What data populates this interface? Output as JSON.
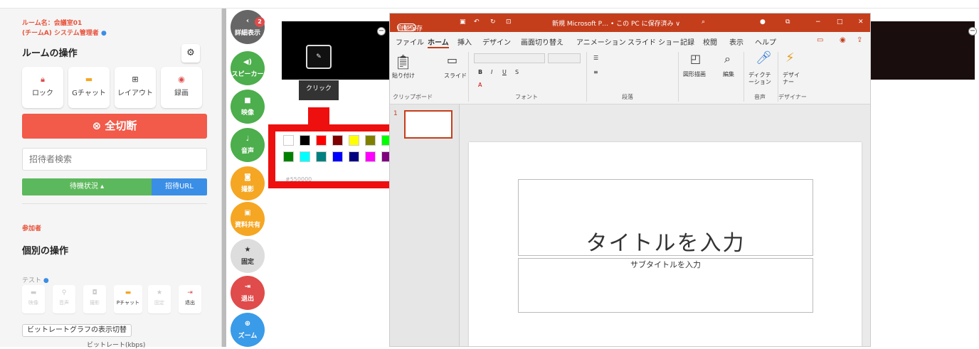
{
  "room": {
    "name": "ルーム名：会議室01",
    "team": "(チームA) システム管理者"
  },
  "ops": {
    "title": "ルームの操作",
    "items": [
      "ロック",
      "Gチャット",
      "レイアウト",
      "録画"
    ],
    "all_cut": "⊗ 全切断"
  },
  "search": {
    "placeholder": "招待者検索"
  },
  "wait_label": "待機状況 ▴",
  "invite_url": "招待URL",
  "participants": "参加者",
  "individual": "個別の操作",
  "test": "テスト",
  "indiv_items": [
    "映像",
    "音声",
    "撮影",
    "Pチャット",
    "固定",
    "退出"
  ],
  "bitrate_toggle": "ビットレートグラフの表示切替",
  "bitrate_unit": "ビットレート(kbps)",
  "side": {
    "badge": "2",
    "items": [
      "詳細表示",
      "スピーカー",
      "映像",
      "音声",
      "撮影",
      "資料共有",
      "固定",
      "退出",
      "ズーム"
    ]
  },
  "draw": {
    "click": "クリック",
    "hex": "#550000"
  },
  "palette": [
    "#ffffff",
    "#000000",
    "#ff0000",
    "#800000",
    "#ffff00",
    "#808000",
    "#00ff00",
    "#008000",
    "#00ffff",
    "#008080",
    "#0000ff",
    "#000080",
    "#ff00ff",
    "#800080"
  ],
  "ppt": {
    "autosave": "自動保存",
    "toggle": "オフ",
    "title": "新規 Microsoft P… • この PC に保存済み ∨",
    "tabs": [
      "ファイル",
      "ホーム",
      "挿入",
      "デザイン",
      "画面切り替え",
      "アニメーション",
      "スライド ショー",
      "記録",
      "校閲",
      "表示",
      "ヘルプ"
    ],
    "groups": [
      "クリップボード",
      "フォント",
      "段落",
      "音声",
      "デザイナー"
    ],
    "ribbon": [
      "貼り付け",
      "スライド",
      "図形描画",
      "編集",
      "ディクテーション",
      "デザイナー"
    ],
    "slide_num": "1",
    "title_ph": "タイトルを入力",
    "sub_ph": "サブタイトルを入力"
  }
}
